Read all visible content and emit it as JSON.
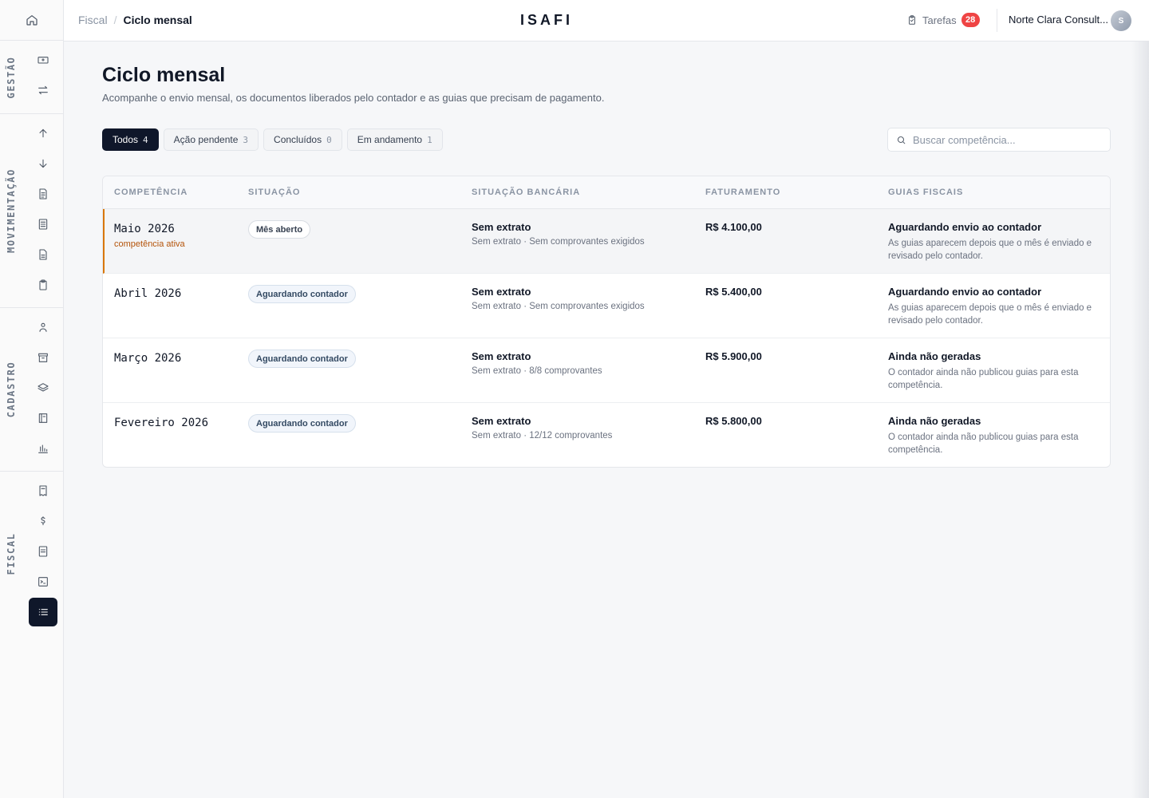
{
  "app": {
    "brand": "ISAFI"
  },
  "breadcrumb": {
    "parent": "Fiscal",
    "separator": "/",
    "current": "Ciclo mensal"
  },
  "header": {
    "tasks_label": "Tarefas",
    "tasks_count": "28",
    "company": "Norte Clara Consult...",
    "avatar_initial": "S"
  },
  "sidebar": {
    "sections": [
      {
        "label": "GESTÃO",
        "icons": [
          "wallet-icon",
          "transfer-icon"
        ]
      },
      {
        "label": "MOVIMENTAÇÃO",
        "icons": [
          "arrow-up-icon",
          "arrow-down-icon",
          "document-icon",
          "document-lines-icon",
          "file-text-icon",
          "clipboard-icon"
        ]
      },
      {
        "label": "CADASTRO",
        "icons": [
          "user-icon",
          "archive-icon",
          "layers-icon",
          "ledger-icon",
          "bar-chart-icon"
        ]
      },
      {
        "label": "FISCAL",
        "icons": [
          "receipt-icon",
          "dollar-icon",
          "invoice-icon",
          "terminal-icon",
          "list-icon"
        ]
      }
    ],
    "active_icon": "list-icon"
  },
  "page": {
    "title": "Ciclo mensal",
    "subtitle": "Acompanhe o envio mensal, os documentos liberados pelo contador e as guias que precisam de pagamento."
  },
  "filters": [
    {
      "label": "Todos",
      "count": "4",
      "active": true
    },
    {
      "label": "Ação pendente",
      "count": "3",
      "active": false
    },
    {
      "label": "Concluídos",
      "count": "0",
      "active": false
    },
    {
      "label": "Em andamento",
      "count": "1",
      "active": false
    }
  ],
  "search": {
    "placeholder": "Buscar competência...",
    "value": ""
  },
  "table": {
    "columns": [
      "COMPETÊNCIA",
      "SITUAÇÃO",
      "SITUAÇÃO BANCÁRIA",
      "FATURAMENTO",
      "GUIAS FISCAIS"
    ],
    "rows": [
      {
        "competencia": "Maio 2026",
        "competencia_sub": "competência ativa",
        "situacao": "Mês aberto",
        "banco_title": "Sem extrato",
        "banco_sub": "Sem extrato · Sem comprovantes exigidos",
        "faturamento": "R$ 4.100,00",
        "guias_title": "Aguardando envio ao contador",
        "guias_sub": "As guias aparecem depois que o mês é enviado e revisado pelo contador."
      },
      {
        "competencia": "Abril 2026",
        "competencia_sub": "",
        "situacao": "Aguardando contador",
        "banco_title": "Sem extrato",
        "banco_sub": "Sem extrato · Sem comprovantes exigidos",
        "faturamento": "R$ 5.400,00",
        "guias_title": "Aguardando envio ao contador",
        "guias_sub": "As guias aparecem depois que o mês é enviado e revisado pelo contador."
      },
      {
        "competencia": "Março 2026",
        "competencia_sub": "",
        "situacao": "Aguardando contador",
        "banco_title": "Sem extrato",
        "banco_sub": "Sem extrato · 8/8 comprovantes",
        "faturamento": "R$ 5.900,00",
        "guias_title": "Ainda não geradas",
        "guias_sub": "O contador ainda não publicou guias para esta competência."
      },
      {
        "competencia": "Fevereiro 2026",
        "competencia_sub": "",
        "situacao": "Aguardando contador",
        "banco_title": "Sem extrato",
        "banco_sub": "Sem extrato · 12/12 comprovantes",
        "faturamento": "R$ 5.800,00",
        "guias_title": "Ainda não geradas",
        "guias_sub": "O contador ainda não publicou guias para esta competência."
      }
    ]
  },
  "colors": {
    "accent": "#0f172a",
    "active_marker": "#d97706",
    "badge": "#ef4444"
  }
}
